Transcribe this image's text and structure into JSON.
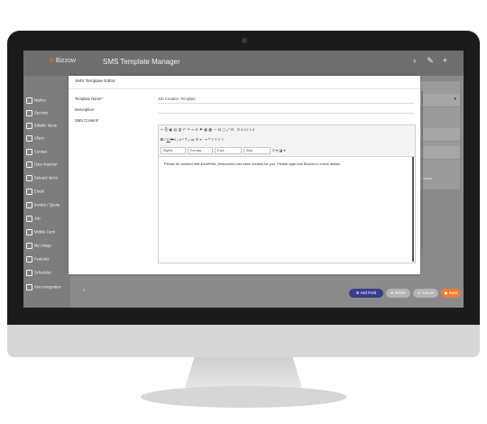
{
  "app": {
    "brand": "Bizzow",
    "title": "SMS Template Manager"
  },
  "sidebar": {
    "items": [
      {
        "label": "Market"
      },
      {
        "label": "Security"
      },
      {
        "label": "Billable Items"
      },
      {
        "label": "Client"
      },
      {
        "label": "Contact"
      },
      {
        "label": "Data Importer"
      },
      {
        "label": "Deleted Items"
      },
      {
        "label": "Email"
      },
      {
        "label": "Invoice / Quote"
      },
      {
        "label": "Job"
      },
      {
        "label": "Mobile Form"
      },
      {
        "label": "My Usage"
      },
      {
        "label": "Features"
      },
      {
        "label": "Scheduler"
      },
      {
        "label": "Xero Integration"
      }
    ]
  },
  "background": {
    "partial_text": "1 items"
  },
  "modal": {
    "title": "SMS Template Editor",
    "template_name_label": "Template Name*",
    "template_name_value": "Job Creation Template",
    "description_label": "Description",
    "content_label": "SMS Content*",
    "editor": {
      "source_label": "Source",
      "styles_label": "Styles",
      "format_label": "Format",
      "font_label": "Font",
      "size_label": "Size",
      "content": "Please be advised that $JobField_Description has been created for you.  Please login into Bizzow to check details."
    },
    "buttons": {
      "add_field": "Add Field",
      "delete": "Delete",
      "cancel": "Cancel",
      "save": "Save"
    }
  }
}
